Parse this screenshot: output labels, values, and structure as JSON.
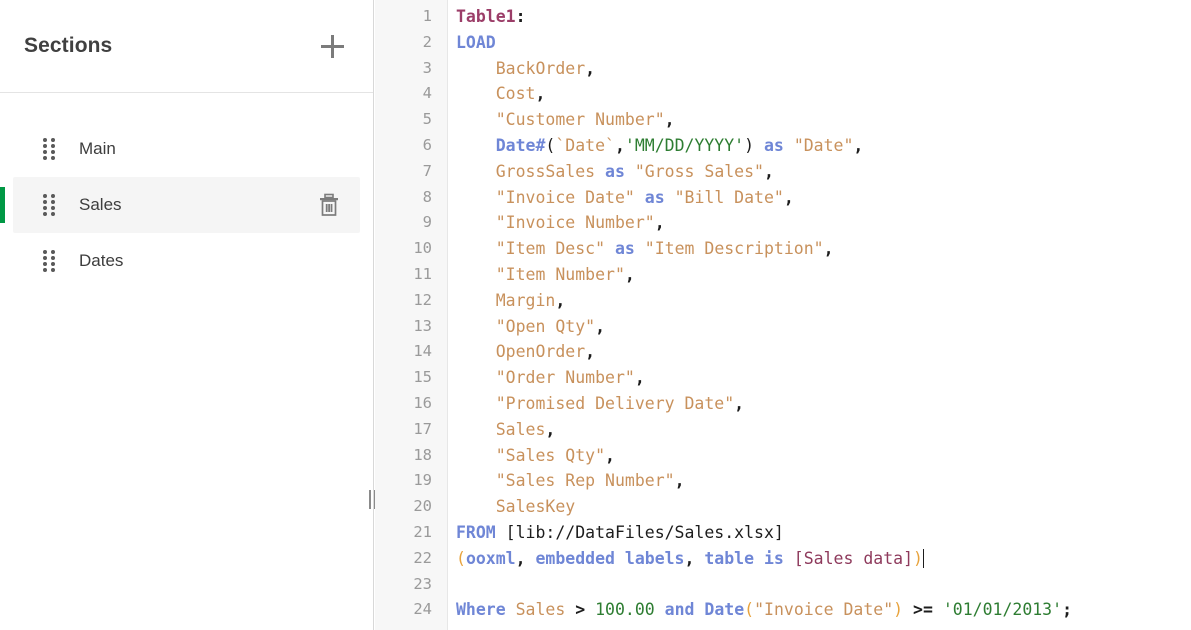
{
  "sidebar": {
    "title": "Sections",
    "add_button_label": "+",
    "add_icon": "plus-icon",
    "items": [
      {
        "label": "Main",
        "selected": false,
        "has_delete": false,
        "grip_icon": "drag-handle-icon"
      },
      {
        "label": "Sales",
        "selected": true,
        "has_delete": true,
        "grip_icon": "drag-handle-icon",
        "delete_icon": "trash-icon"
      },
      {
        "label": "Dates",
        "selected": false,
        "has_delete": false,
        "grip_icon": "drag-handle-icon"
      }
    ],
    "accent_color": "#009845",
    "selected_row_bg": "#f5f5f5"
  },
  "splitter": {
    "handle_icon": "resize-handle-icon"
  },
  "editor": {
    "line_numbers": [
      "1",
      "2",
      "3",
      "4",
      "5",
      "6",
      "7",
      "8",
      "9",
      "10",
      "11",
      "12",
      "13",
      "14",
      "15",
      "16",
      "17",
      "18",
      "19",
      "20",
      "21",
      "22",
      "23",
      "24"
    ],
    "cursor_line": 22,
    "colors": {
      "label": "#9b3d68",
      "keyword": "#6f86d6",
      "field": "#c8915c",
      "string": "#2e7d32",
      "number": "#2e7d32",
      "paren_match": "#e8a33d",
      "table_ref": "#8e3a5c",
      "plain": "#1d1d1d",
      "gutter_bg": "#f7f7f7",
      "gutter_text": "#9a9a9a"
    },
    "lines": [
      {
        "n": 1,
        "text": "Table1:",
        "tokens": [
          {
            "t": "label",
            "v": "Table1"
          },
          {
            "t": "punct",
            "v": ":"
          }
        ]
      },
      {
        "n": 2,
        "text": "LOAD",
        "tokens": [
          {
            "t": "kw",
            "v": "LOAD"
          }
        ]
      },
      {
        "n": 3,
        "text": "    BackOrder,",
        "tokens": [
          {
            "t": "plain",
            "v": "    "
          },
          {
            "t": "field",
            "v": "BackOrder"
          },
          {
            "t": "punct",
            "v": ","
          }
        ]
      },
      {
        "n": 4,
        "text": "    Cost,",
        "tokens": [
          {
            "t": "plain",
            "v": "    "
          },
          {
            "t": "field",
            "v": "Cost"
          },
          {
            "t": "punct",
            "v": ","
          }
        ]
      },
      {
        "n": 5,
        "text": "    \"Customer Number\",",
        "tokens": [
          {
            "t": "plain",
            "v": "    "
          },
          {
            "t": "field",
            "v": "\"Customer Number\""
          },
          {
            "t": "punct",
            "v": ","
          }
        ]
      },
      {
        "n": 6,
        "text": "    Date#(`Date`,'MM/DD/YYYY') as \"Date\",",
        "tokens": [
          {
            "t": "plain",
            "v": "    "
          },
          {
            "t": "kw",
            "v": "Date#"
          },
          {
            "t": "plain",
            "v": "("
          },
          {
            "t": "field",
            "v": "`Date`"
          },
          {
            "t": "punct",
            "v": ","
          },
          {
            "t": "str",
            "v": "'MM/DD/YYYY'"
          },
          {
            "t": "plain",
            "v": ")"
          },
          {
            "t": "plain",
            "v": " "
          },
          {
            "t": "kw",
            "v": "as"
          },
          {
            "t": "plain",
            "v": " "
          },
          {
            "t": "field",
            "v": "\"Date\""
          },
          {
            "t": "punct",
            "v": ","
          }
        ]
      },
      {
        "n": 7,
        "text": "    GrossSales as \"Gross Sales\",",
        "tokens": [
          {
            "t": "plain",
            "v": "    "
          },
          {
            "t": "field",
            "v": "GrossSales"
          },
          {
            "t": "plain",
            "v": " "
          },
          {
            "t": "kw",
            "v": "as"
          },
          {
            "t": "plain",
            "v": " "
          },
          {
            "t": "field",
            "v": "\"Gross Sales\""
          },
          {
            "t": "punct",
            "v": ","
          }
        ]
      },
      {
        "n": 8,
        "text": "    \"Invoice Date\" as \"Bill Date\",",
        "tokens": [
          {
            "t": "plain",
            "v": "    "
          },
          {
            "t": "field",
            "v": "\"Invoice Date\""
          },
          {
            "t": "plain",
            "v": " "
          },
          {
            "t": "kw",
            "v": "as"
          },
          {
            "t": "plain",
            "v": " "
          },
          {
            "t": "field",
            "v": "\"Bill Date\""
          },
          {
            "t": "punct",
            "v": ","
          }
        ]
      },
      {
        "n": 9,
        "text": "    \"Invoice Number\",",
        "tokens": [
          {
            "t": "plain",
            "v": "    "
          },
          {
            "t": "field",
            "v": "\"Invoice Number\""
          },
          {
            "t": "punct",
            "v": ","
          }
        ]
      },
      {
        "n": 10,
        "text": "    \"Item Desc\" as \"Item Description\",",
        "tokens": [
          {
            "t": "plain",
            "v": "    "
          },
          {
            "t": "field",
            "v": "\"Item Desc\""
          },
          {
            "t": "plain",
            "v": " "
          },
          {
            "t": "kw",
            "v": "as"
          },
          {
            "t": "plain",
            "v": " "
          },
          {
            "t": "field",
            "v": "\"Item Description\""
          },
          {
            "t": "punct",
            "v": ","
          }
        ]
      },
      {
        "n": 11,
        "text": "    \"Item Number\",",
        "tokens": [
          {
            "t": "plain",
            "v": "    "
          },
          {
            "t": "field",
            "v": "\"Item Number\""
          },
          {
            "t": "punct",
            "v": ","
          }
        ]
      },
      {
        "n": 12,
        "text": "    Margin,",
        "tokens": [
          {
            "t": "plain",
            "v": "    "
          },
          {
            "t": "field",
            "v": "Margin"
          },
          {
            "t": "punct",
            "v": ","
          }
        ]
      },
      {
        "n": 13,
        "text": "    \"Open Qty\",",
        "tokens": [
          {
            "t": "plain",
            "v": "    "
          },
          {
            "t": "field",
            "v": "\"Open Qty\""
          },
          {
            "t": "punct",
            "v": ","
          }
        ]
      },
      {
        "n": 14,
        "text": "    OpenOrder,",
        "tokens": [
          {
            "t": "plain",
            "v": "    "
          },
          {
            "t": "field",
            "v": "OpenOrder"
          },
          {
            "t": "punct",
            "v": ","
          }
        ]
      },
      {
        "n": 15,
        "text": "    \"Order Number\",",
        "tokens": [
          {
            "t": "plain",
            "v": "    "
          },
          {
            "t": "field",
            "v": "\"Order Number\""
          },
          {
            "t": "punct",
            "v": ","
          }
        ]
      },
      {
        "n": 16,
        "text": "    \"Promised Delivery Date\",",
        "tokens": [
          {
            "t": "plain",
            "v": "    "
          },
          {
            "t": "field",
            "v": "\"Promised Delivery Date\""
          },
          {
            "t": "punct",
            "v": ","
          }
        ]
      },
      {
        "n": 17,
        "text": "    Sales,",
        "tokens": [
          {
            "t": "plain",
            "v": "    "
          },
          {
            "t": "field",
            "v": "Sales"
          },
          {
            "t": "punct",
            "v": ","
          }
        ]
      },
      {
        "n": 18,
        "text": "    \"Sales Qty\",",
        "tokens": [
          {
            "t": "plain",
            "v": "    "
          },
          {
            "t": "field",
            "v": "\"Sales Qty\""
          },
          {
            "t": "punct",
            "v": ","
          }
        ]
      },
      {
        "n": 19,
        "text": "    \"Sales Rep Number\",",
        "tokens": [
          {
            "t": "plain",
            "v": "    "
          },
          {
            "t": "field",
            "v": "\"Sales Rep Number\""
          },
          {
            "t": "punct",
            "v": ","
          }
        ]
      },
      {
        "n": 20,
        "text": "    SalesKey",
        "tokens": [
          {
            "t": "plain",
            "v": "    "
          },
          {
            "t": "field",
            "v": "SalesKey"
          }
        ]
      },
      {
        "n": 21,
        "text": "FROM [lib://DataFiles/Sales.xlsx]",
        "tokens": [
          {
            "t": "kw",
            "v": "FROM"
          },
          {
            "t": "plain",
            "v": " [lib://DataFiles/Sales.xlsx]"
          }
        ]
      },
      {
        "n": 22,
        "text": "(ooxml, embedded labels, table is [Sales data])",
        "tokens": [
          {
            "t": "paren",
            "v": "("
          },
          {
            "t": "kw",
            "v": "ooxml"
          },
          {
            "t": "punct",
            "v": ","
          },
          {
            "t": "plain",
            "v": " "
          },
          {
            "t": "kw",
            "v": "embedded labels"
          },
          {
            "t": "punct",
            "v": ","
          },
          {
            "t": "plain",
            "v": " "
          },
          {
            "t": "kw",
            "v": "table is"
          },
          {
            "t": "plain",
            "v": " "
          },
          {
            "t": "tbl",
            "v": "[Sales data]"
          },
          {
            "t": "paren",
            "v": ")"
          }
        ]
      },
      {
        "n": 23,
        "text": "",
        "tokens": []
      },
      {
        "n": 24,
        "text": "Where Sales > 100.00 and Date(\"Invoice Date\") >= '01/01/2013';",
        "tokens": [
          {
            "t": "kw",
            "v": "Where"
          },
          {
            "t": "plain",
            "v": " "
          },
          {
            "t": "field",
            "v": "Sales"
          },
          {
            "t": "plain",
            "v": " "
          },
          {
            "t": "punct",
            "v": ">"
          },
          {
            "t": "plain",
            "v": " "
          },
          {
            "t": "num",
            "v": "100.00"
          },
          {
            "t": "plain",
            "v": " "
          },
          {
            "t": "kw",
            "v": "and"
          },
          {
            "t": "plain",
            "v": " "
          },
          {
            "t": "kw",
            "v": "Date"
          },
          {
            "t": "paren",
            "v": "("
          },
          {
            "t": "field",
            "v": "\"Invoice Date\""
          },
          {
            "t": "paren",
            "v": ")"
          },
          {
            "t": "plain",
            "v": " "
          },
          {
            "t": "punct",
            "v": ">="
          },
          {
            "t": "plain",
            "v": " "
          },
          {
            "t": "str",
            "v": "'01/01/2013'"
          },
          {
            "t": "punct",
            "v": ";"
          }
        ]
      }
    ]
  }
}
